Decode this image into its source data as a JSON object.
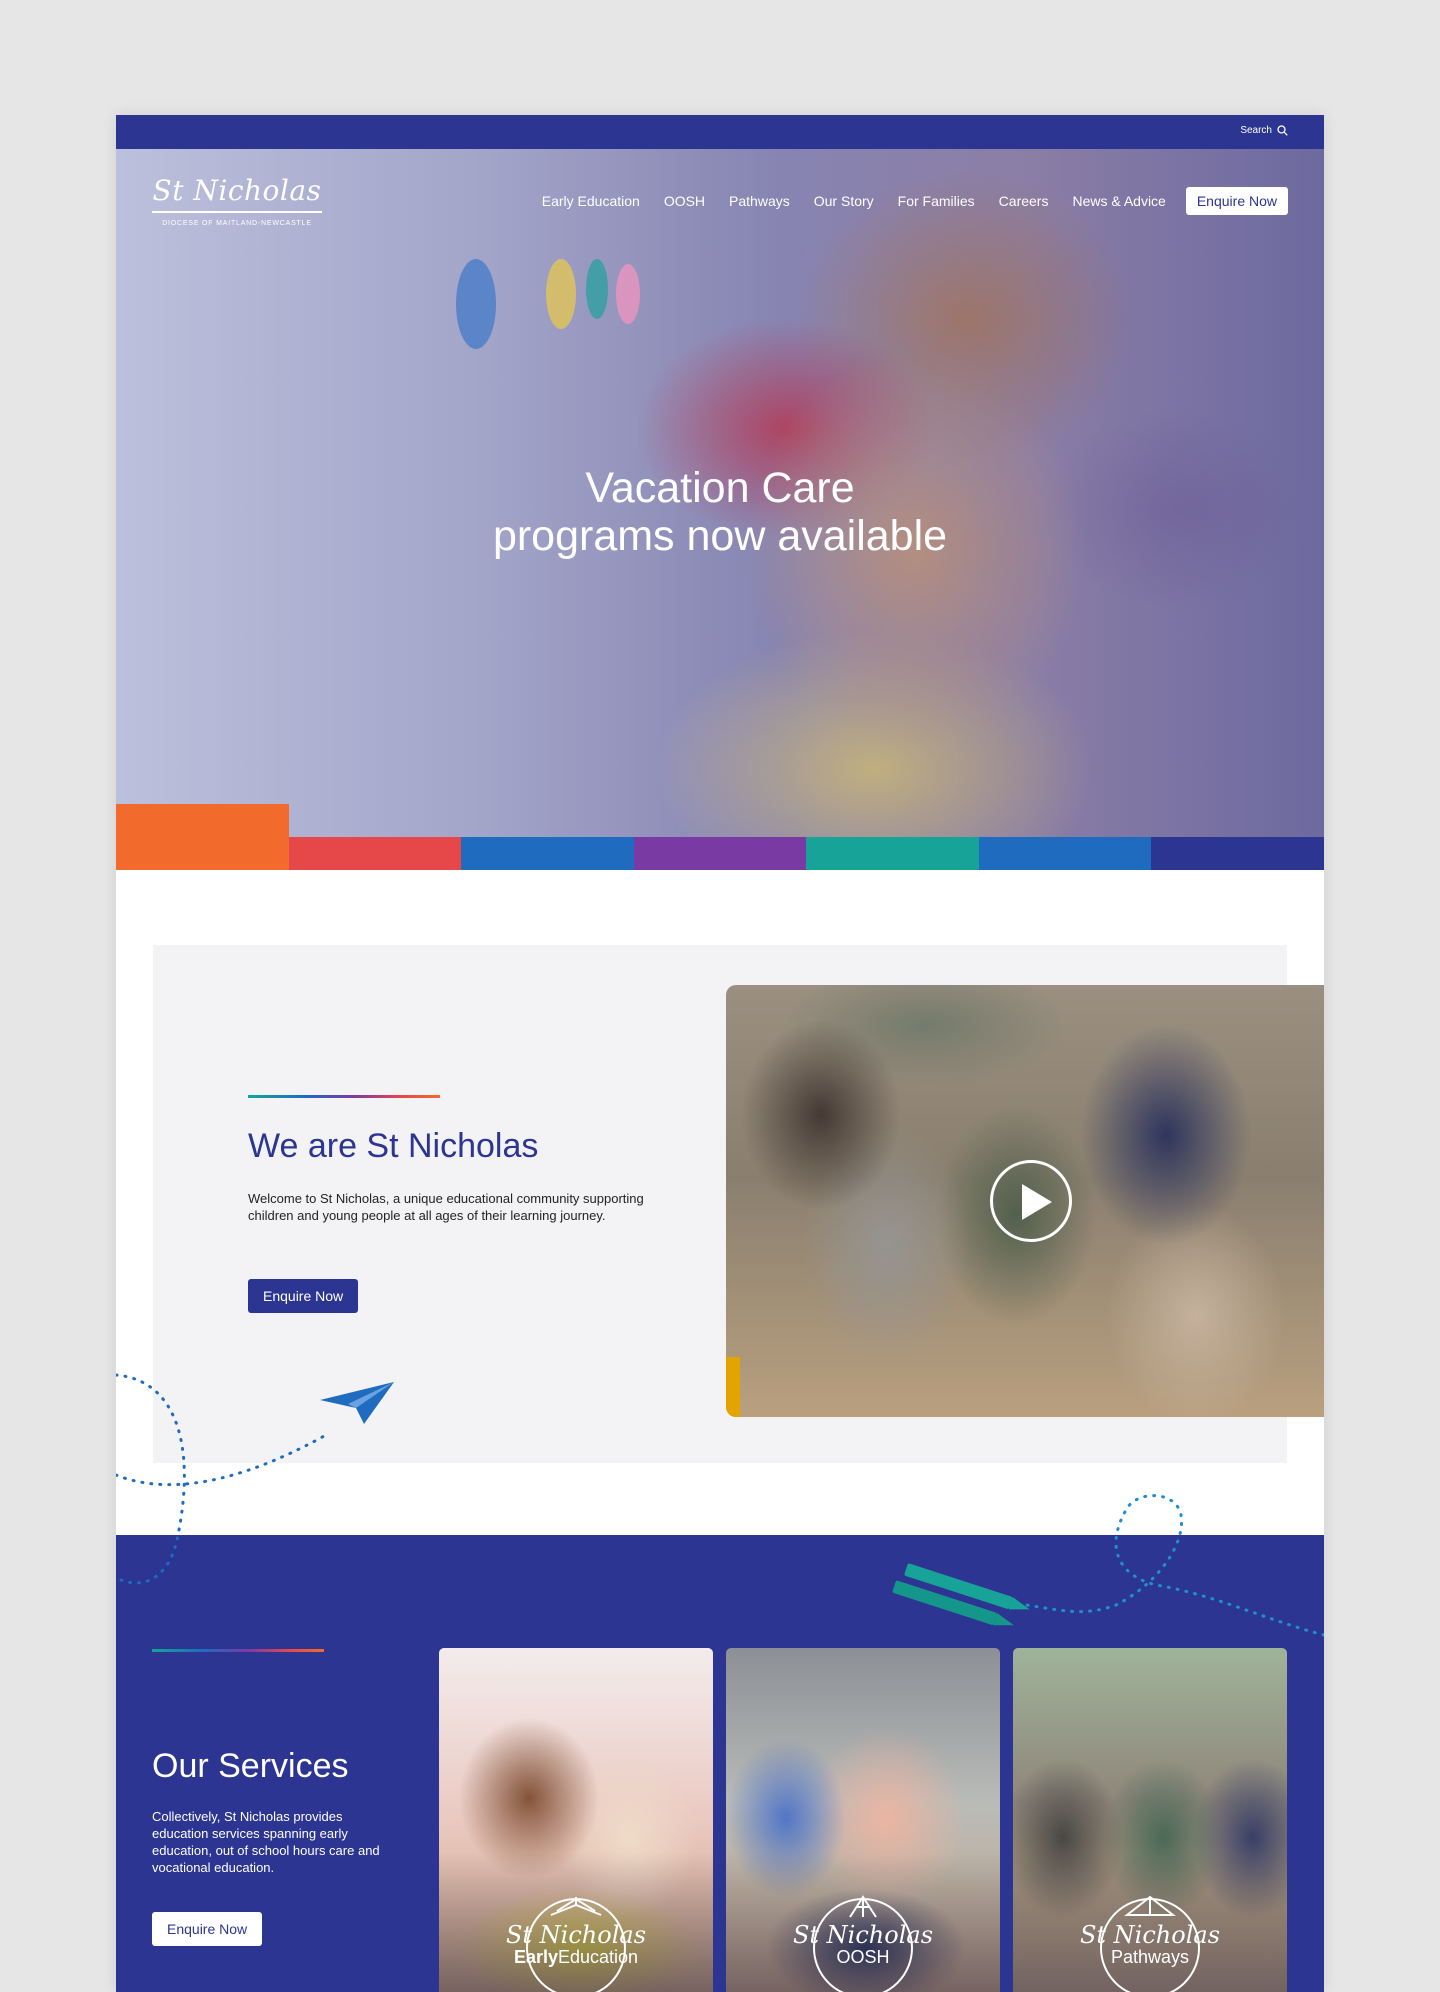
{
  "utility_bar": {
    "search_label": "Search"
  },
  "header": {
    "logo_name": "St Nicholas",
    "logo_tagline": "DIOCESE OF MAITLAND-NEWCASTLE",
    "nav_items": [
      "Early Education",
      "OOSH",
      "Pathways",
      "Our Story",
      "For Families",
      "Careers",
      "News & Advice"
    ],
    "cta_label": "Enquire Now"
  },
  "hero": {
    "title_line1": "Vacation Care",
    "title_line2": "programs now available"
  },
  "stripe_colors": [
    "#f26a2c",
    "#e6484a",
    "#1f6bc0",
    "#7a3aa3",
    "#17a397",
    "#1f6bc0",
    "#2c3591"
  ],
  "about": {
    "title": "We are St Nicholas",
    "body": "Welcome to St Nicholas, a unique educational community supporting children and young people at all ages of their learning journey.",
    "button_label": "Enquire Now"
  },
  "services": {
    "title": "Our Services",
    "body": "Collectively, St Nicholas provides education services spanning early education, out of school hours care and vocational education.",
    "button_label": "Enquire Now",
    "cards": [
      {
        "brand": "St Nicholas",
        "sub_bold": "Early",
        "sub_rest": "Education"
      },
      {
        "brand": "St Nicholas",
        "sub_bold": "",
        "sub_rest": "OOSH"
      },
      {
        "brand": "St Nicholas",
        "sub_bold": "",
        "sub_rest": "Pathways"
      }
    ]
  },
  "colors": {
    "brand_navy": "#2c3591",
    "orange": "#f26a2c",
    "red": "#e6484a",
    "blue": "#1f6bc0",
    "purple": "#7a3aa3",
    "teal": "#17a397"
  },
  "icons": [
    "search-icon",
    "play-icon",
    "paper-plane-icon",
    "crayons-icon",
    "book-icon",
    "rocket-icon"
  ]
}
